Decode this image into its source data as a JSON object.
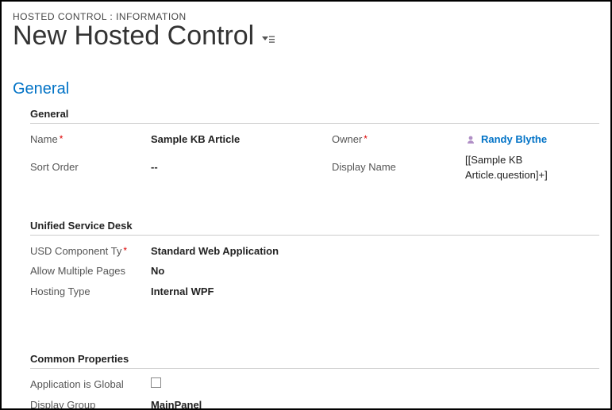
{
  "breadcrumb": "HOSTED CONTROL : INFORMATION",
  "title": "New Hosted Control",
  "section_general_header": "General",
  "subsections": {
    "general": {
      "title": "General",
      "name_label": "Name",
      "name_value": "Sample KB Article",
      "owner_label": "Owner",
      "owner_value": "Randy Blythe",
      "sortorder_label": "Sort Order",
      "sortorder_value": "--",
      "displayname_label": "Display Name",
      "displayname_value": "[[Sample KB Article.question]+]"
    },
    "usd": {
      "title": "Unified Service Desk",
      "componenttype_label": "USD Component Ty",
      "componenttype_value": "Standard Web Application",
      "allowmulti_label": "Allow Multiple Pages",
      "allowmulti_value": "No",
      "hostingtype_label": "Hosting Type",
      "hostingtype_value": "Internal WPF"
    },
    "common": {
      "title": "Common Properties",
      "appglobal_label": "Application is Global",
      "displaygroup_label": "Display Group",
      "displaygroup_value": "MainPanel"
    }
  }
}
